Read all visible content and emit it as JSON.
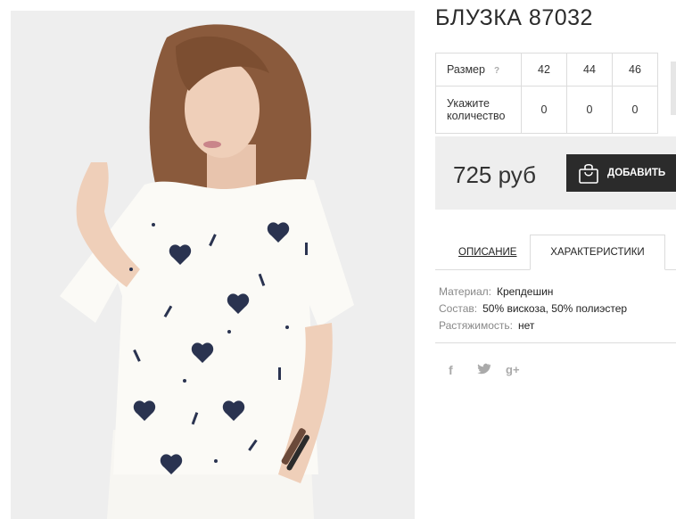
{
  "product": {
    "title": "БЛУЗКА 87032",
    "image_alt": "model wearing white blouse with navy print"
  },
  "size_table": {
    "size_label": "Размер",
    "help": "?",
    "sizes": [
      "42",
      "44",
      "46"
    ],
    "qty_label": "Укажите количество",
    "quantities": [
      "0",
      "0",
      "0"
    ]
  },
  "purchase": {
    "price": "725 руб",
    "cart_label": "ДОБАВИТЬ",
    "cart_icon": "shopping-bag-icon"
  },
  "tabs": {
    "description": "ОПИСАНИЕ",
    "characteristics": "ХАРАКТЕРИСТИКИ"
  },
  "specs": [
    {
      "key": "Материал:",
      "value": "Крепдешин"
    },
    {
      "key": "Состав:",
      "value": "50% вискоза, 50% полиэстер"
    },
    {
      "key": "Растяжимость:",
      "value": "нет"
    }
  ],
  "social": {
    "facebook": "f",
    "twitter": "🐦",
    "googleplus": "g+"
  },
  "colors": {
    "background_box": "#eeeeee",
    "button": "#2b2b2b",
    "print": "#2a3350"
  }
}
